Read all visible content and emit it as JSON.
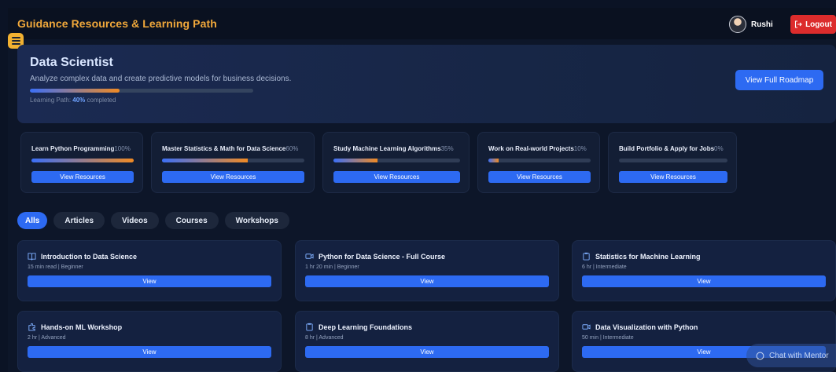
{
  "header": {
    "title": "Guidance Resources & Learning Path",
    "user_name": "Rushi",
    "logout_label": "Logout"
  },
  "hero": {
    "title": "Data Scientist",
    "description": "Analyze complex data and create predictive models for business decisions.",
    "path_prefix": "Learning Path:",
    "progress_text": "40%",
    "path_suffix": "completed",
    "progress": 0.4,
    "roadmap_label": "View Full Roadmap"
  },
  "steps": [
    {
      "title": "Learn Python Programming",
      "pct": "100%",
      "progress": 1.0,
      "button": "View Resources"
    },
    {
      "title": "Master Statistics & Math for Data Science",
      "pct": "60%",
      "progress": 0.6,
      "button": "View Resources"
    },
    {
      "title": "Study Machine Learning Algorithms",
      "pct": "35%",
      "progress": 0.35,
      "button": "View Resources"
    },
    {
      "title": "Work on Real-world Projects",
      "pct": "10%",
      "progress": 0.1,
      "button": "View Resources"
    },
    {
      "title": "Build Portfolio & Apply for Jobs",
      "pct": "0%",
      "progress": 0.0,
      "button": "View Resources"
    }
  ],
  "filters": [
    "Alls",
    "Articles",
    "Videos",
    "Courses",
    "Workshops"
  ],
  "active_filter": "Alls",
  "resources": [
    {
      "icon": "book-icon",
      "title": "Introduction to Data Science",
      "meta": "15 min read | Beginner",
      "button": "View"
    },
    {
      "icon": "video-icon",
      "title": "Python for Data Science - Full Course",
      "meta": "1 hr 20 min | Beginner",
      "button": "View"
    },
    {
      "icon": "clipboard-icon",
      "title": "Statistics for Machine Learning",
      "meta": "6 hr | Intermediate",
      "button": "View"
    },
    {
      "icon": "puzzle-icon",
      "title": "Hands-on ML Workshop",
      "meta": "2 hr | Advanced",
      "button": "View"
    },
    {
      "icon": "clipboard-icon",
      "title": "Deep Learning Foundations",
      "meta": "8 hr | Advanced",
      "button": "View"
    },
    {
      "icon": "video-icon",
      "title": "Data Visualization with Python",
      "meta": "50 min | Intermediate",
      "button": "View"
    }
  ],
  "chat": {
    "label": "Chat with Mentor"
  },
  "colors": {
    "accent": "#2d6af2",
    "title": "#f2a93b",
    "logout": "#dc2c2c",
    "progress_start": "#3b6ff7",
    "progress_end": "#f08a24"
  }
}
